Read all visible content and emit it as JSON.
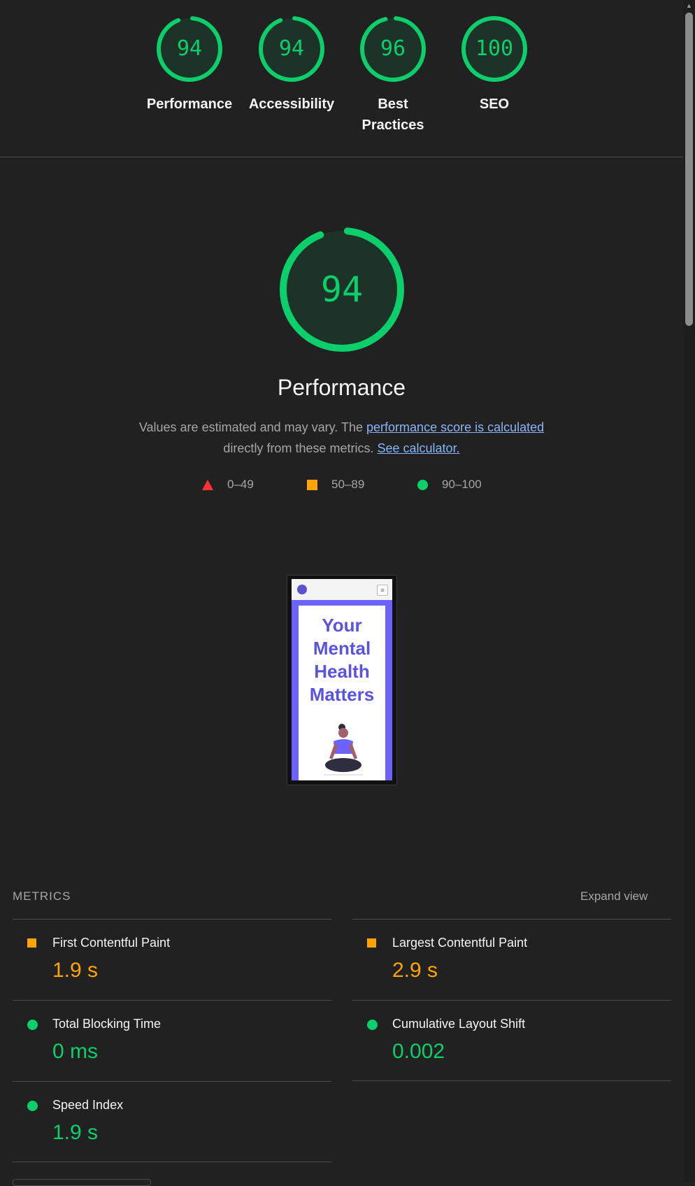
{
  "gauges": [
    {
      "score": 94,
      "label": "Performance"
    },
    {
      "score": 94,
      "label": "Accessibility"
    },
    {
      "score": 96,
      "label": "Best Practices"
    },
    {
      "score": 100,
      "label": "SEO"
    }
  ],
  "performance": {
    "score": 94,
    "title": "Performance",
    "desc_text": "Values are estimated and may vary. The",
    "desc_link": "performance score is calculated",
    "desc_text2": "directly from these metrics.",
    "calc_link": "See calculator."
  },
  "legend": {
    "fail": "0–49",
    "average": "50–89",
    "pass": "90–100"
  },
  "thumbnail": {
    "headline": "Your Mental Health Matters",
    "menu_icon": "≡"
  },
  "metrics": {
    "header": "METRICS",
    "expand": "Expand view",
    "items": [
      {
        "name": "First Contentful Paint",
        "value": "1.9 s",
        "rating": "average"
      },
      {
        "name": "Largest Contentful Paint",
        "value": "2.9 s",
        "rating": "average"
      },
      {
        "name": "Total Blocking Time",
        "value": "0 ms",
        "rating": "pass"
      },
      {
        "name": "Cumulative Layout Shift",
        "value": "0.002",
        "rating": "pass"
      },
      {
        "name": "Speed Index",
        "value": "1.9 s",
        "rating": "pass"
      }
    ]
  },
  "colors": {
    "pass": "#0cce6b",
    "average": "#ffa400",
    "fail": "#ff3333",
    "background": "#212121",
    "link": "#8ab4f8"
  }
}
